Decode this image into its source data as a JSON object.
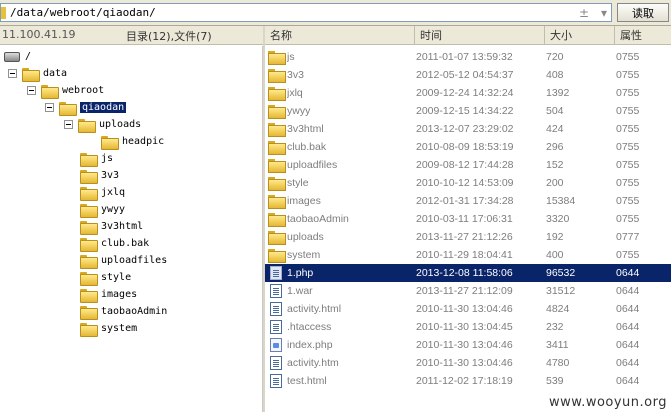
{
  "address": {
    "path": "/data/webroot/qiaodan/",
    "plus": "±",
    "dropdown": "▾",
    "read_button": "读取"
  },
  "left_header": {
    "ip": "11.100.41.19",
    "summary": "目录(12),文件(7)"
  },
  "columns": {
    "name": "名称",
    "time": "时间",
    "size": "大小",
    "perm": "属性"
  },
  "tree": [
    {
      "label": "/",
      "type": "drive",
      "toggle": false
    },
    {
      "label": "data",
      "type": "folder",
      "toggle": true
    },
    {
      "label": "webroot",
      "type": "folder",
      "toggle": true
    },
    {
      "label": "qiaodan",
      "type": "folder",
      "toggle": true,
      "selected": true
    },
    {
      "label": "uploads",
      "type": "folder",
      "toggle": true
    },
    {
      "label": "headpic",
      "type": "folder",
      "toggle": false
    },
    {
      "label": "js",
      "type": "folder",
      "toggle": false
    },
    {
      "label": "3v3",
      "type": "folder",
      "toggle": false
    },
    {
      "label": "jxlq",
      "type": "folder",
      "toggle": false
    },
    {
      "label": "ywyy",
      "type": "folder",
      "toggle": false
    },
    {
      "label": "3v3html",
      "type": "folder",
      "toggle": false
    },
    {
      "label": "club.bak",
      "type": "folder",
      "toggle": false
    },
    {
      "label": "uploadfiles",
      "type": "folder",
      "toggle": false
    },
    {
      "label": "style",
      "type": "folder",
      "toggle": false
    },
    {
      "label": "images",
      "type": "folder",
      "toggle": false
    },
    {
      "label": "taobaoAdmin",
      "type": "folder",
      "toggle": false
    },
    {
      "label": "system",
      "type": "folder",
      "toggle": false
    }
  ],
  "files": [
    {
      "name": "js",
      "time": "2011-01-07 13:59:32",
      "size": "720",
      "perm": "0755",
      "icon": "folder"
    },
    {
      "name": "3v3",
      "time": "2012-05-12 04:54:37",
      "size": "408",
      "perm": "0755",
      "icon": "folder"
    },
    {
      "name": "jxlq",
      "time": "2009-12-24 14:32:24",
      "size": "1392",
      "perm": "0755",
      "icon": "folder"
    },
    {
      "name": "ywyy",
      "time": "2009-12-15 14:34:22",
      "size": "504",
      "perm": "0755",
      "icon": "folder"
    },
    {
      "name": "3v3html",
      "time": "2013-12-07 23:29:02",
      "size": "424",
      "perm": "0755",
      "icon": "folder"
    },
    {
      "name": "club.bak",
      "time": "2010-08-09 18:53:19",
      "size": "296",
      "perm": "0755",
      "icon": "folder"
    },
    {
      "name": "uploadfiles",
      "time": "2009-08-12 17:44:28",
      "size": "152",
      "perm": "0755",
      "icon": "folder"
    },
    {
      "name": "style",
      "time": "2010-10-12 14:53:09",
      "size": "200",
      "perm": "0755",
      "icon": "folder"
    },
    {
      "name": "images",
      "time": "2012-01-31 17:34:28",
      "size": "15384",
      "perm": "0755",
      "icon": "folder"
    },
    {
      "name": "taobaoAdmin",
      "time": "2010-03-11 17:06:31",
      "size": "3320",
      "perm": "0755",
      "icon": "folder"
    },
    {
      "name": "uploads",
      "time": "2013-11-27 21:12:26",
      "size": "192",
      "perm": "0777",
      "icon": "folder"
    },
    {
      "name": "system",
      "time": "2010-11-29 18:04:41",
      "size": "400",
      "perm": "0755",
      "icon": "folder"
    },
    {
      "name": "1.php",
      "time": "2013-12-08 11:58:06",
      "size": "96532",
      "perm": "0644",
      "icon": "doc",
      "selected": true
    },
    {
      "name": "1.war",
      "time": "2013-11-27 21:12:09",
      "size": "31512",
      "perm": "0644",
      "icon": "doc"
    },
    {
      "name": "activity.html",
      "time": "2010-11-30 13:04:46",
      "size": "4824",
      "perm": "0644",
      "icon": "doc"
    },
    {
      "name": ".htaccess",
      "time": "2010-11-30 13:04:45",
      "size": "232",
      "perm": "0644",
      "icon": "doc"
    },
    {
      "name": "index.php",
      "time": "2010-11-30 13:04:46",
      "size": "3411",
      "perm": "0644",
      "icon": "php"
    },
    {
      "name": "activity.htm",
      "time": "2010-11-30 13:04:46",
      "size": "4780",
      "perm": "0644",
      "icon": "doc"
    },
    {
      "name": "test.html",
      "time": "2011-12-02 17:18:19",
      "size": "539",
      "perm": "0644",
      "icon": "doc"
    }
  ],
  "watermark": "www.wooyun.org",
  "colors": {
    "selection": "#0a246a",
    "folder": "#e5b834",
    "chrome": "#ece9d8"
  }
}
